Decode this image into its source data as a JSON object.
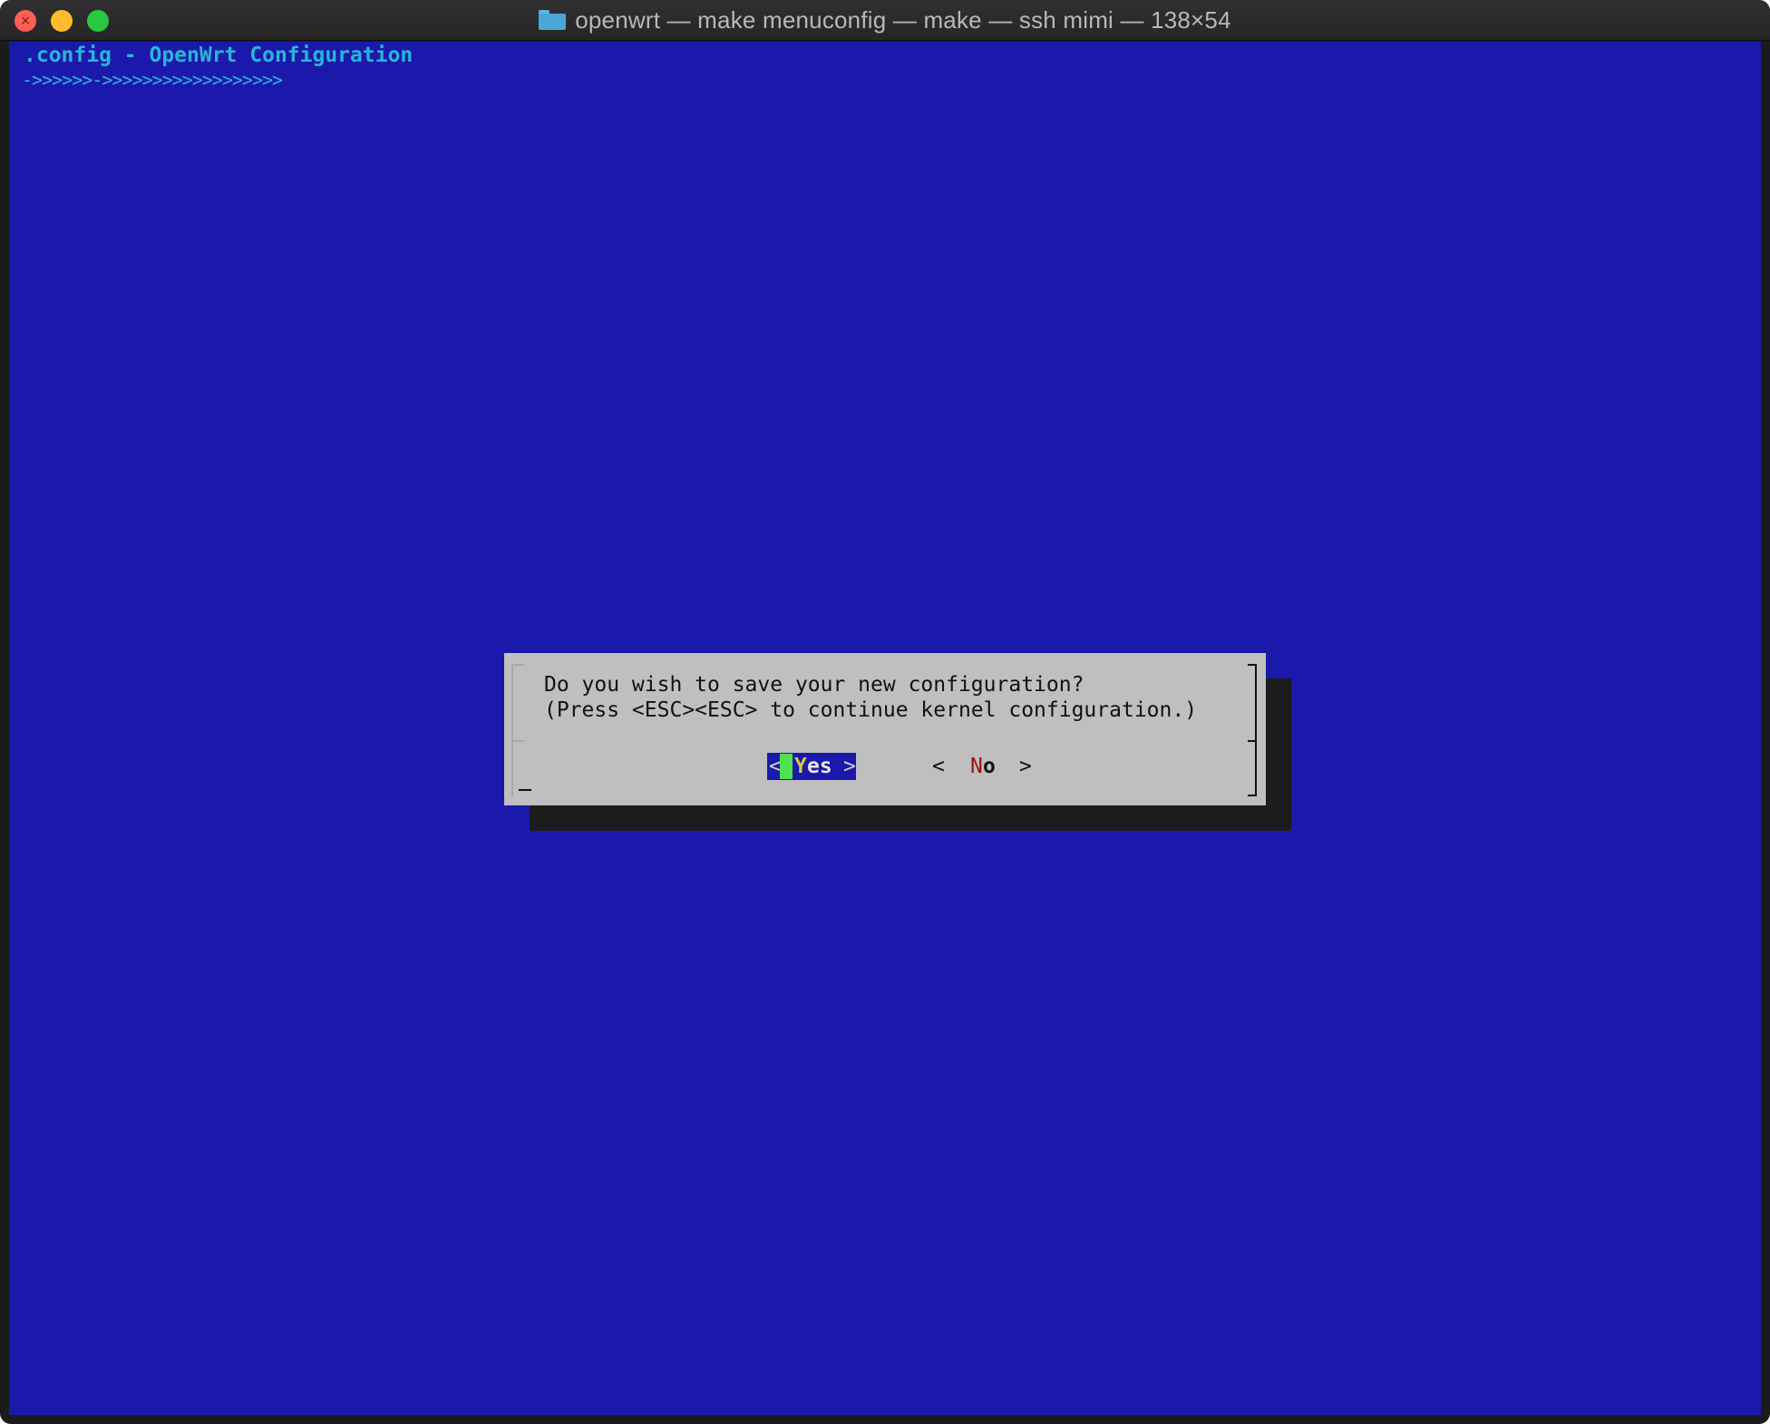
{
  "window": {
    "title": "openwrt — make menuconfig — make — ssh mimi — 138×54",
    "folder_icon": "folder-icon",
    "buttons": [
      "close",
      "minimize",
      "maximize"
    ]
  },
  "terminal": {
    "background_color": "#1b19ab",
    "backtitle": ".config - OpenWrt Configuration",
    "backtitle_line": "->>>>>>->>>>>>>>>>>>>>>>>>",
    "dialog": {
      "message_line1": "Do you wish to save your new configuration?",
      "message_line2": "(Press <ESC><ESC> to continue kernel configuration.)",
      "buttons": {
        "yes": {
          "open": "<",
          "hotkey": "Y",
          "rest": "es",
          "close": ">",
          "selected": true
        },
        "no": {
          "open": "<",
          "hotkey": "N",
          "rest": "o",
          "close": ">",
          "selected": false
        }
      }
    }
  }
}
